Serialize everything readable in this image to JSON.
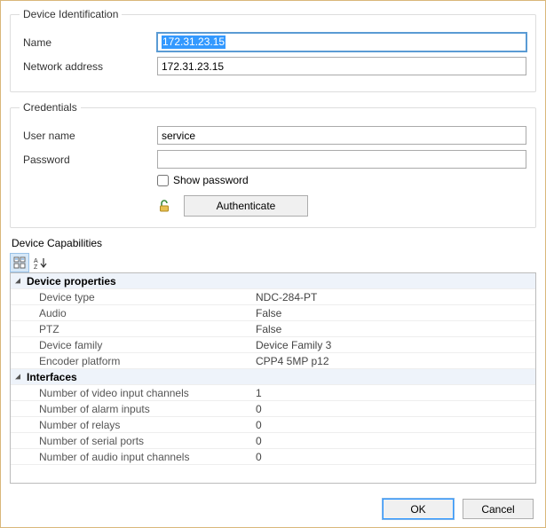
{
  "identification": {
    "legend": "Device Identification",
    "name_label": "Name",
    "name_value": "172.31.23.15",
    "addr_label": "Network address",
    "addr_value": "172.31.23.15"
  },
  "credentials": {
    "legend": "Credentials",
    "user_label": "User name",
    "user_value": "service",
    "pass_label": "Password",
    "pass_value": "",
    "show_pass_label": "Show password",
    "auth_button": "Authenticate"
  },
  "capabilities": {
    "legend": "Device Capabilities",
    "sort_label": "A↓Z",
    "categories": [
      {
        "name": "Device properties",
        "props": [
          {
            "name": "Device type",
            "value": "NDC-284-PT"
          },
          {
            "name": "Audio",
            "value": "False"
          },
          {
            "name": "PTZ",
            "value": "False"
          },
          {
            "name": "Device family",
            "value": "Device Family 3"
          },
          {
            "name": "Encoder platform",
            "value": "CPP4 5MP p12"
          }
        ]
      },
      {
        "name": "Interfaces",
        "props": [
          {
            "name": "Number of video input channels",
            "value": "1"
          },
          {
            "name": "Number of alarm inputs",
            "value": "0"
          },
          {
            "name": "Number of relays",
            "value": "0"
          },
          {
            "name": "Number of serial ports",
            "value": "0"
          },
          {
            "name": "Number of audio input channels",
            "value": "0"
          }
        ]
      }
    ]
  },
  "buttons": {
    "ok": "OK",
    "cancel": "Cancel"
  }
}
